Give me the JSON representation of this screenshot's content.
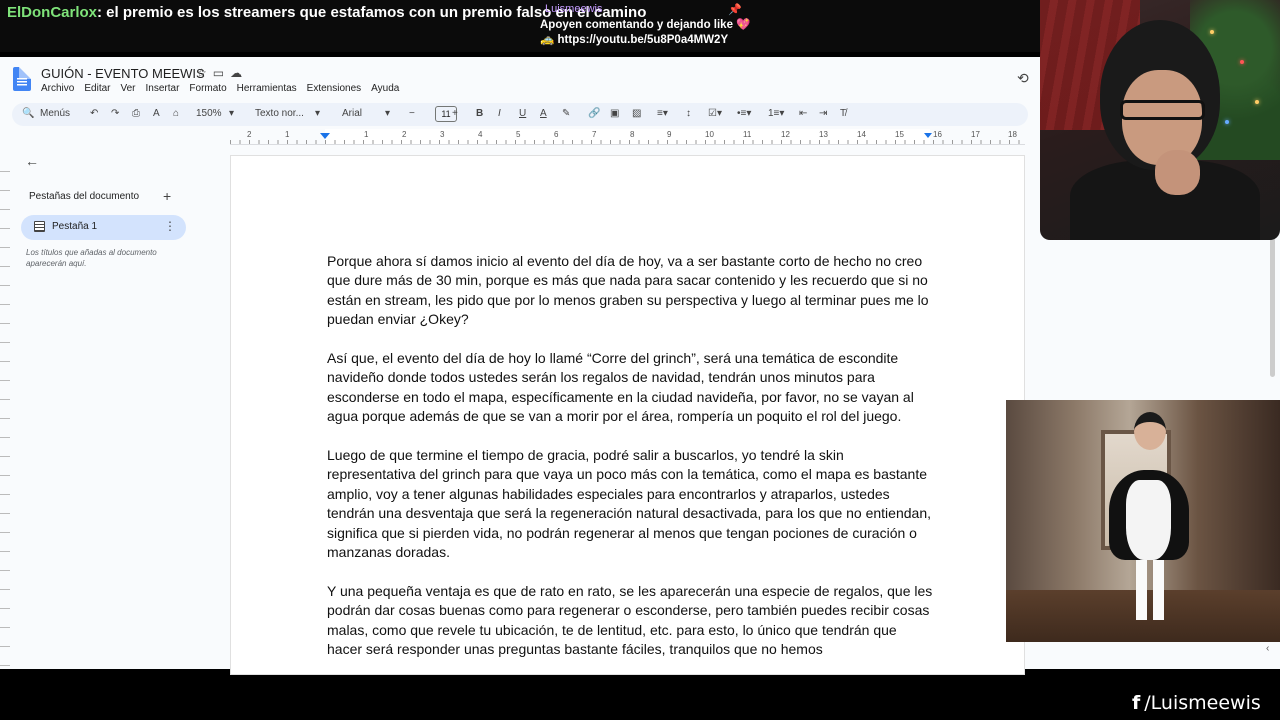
{
  "stream": {
    "chat_user": "ElDonCarlox",
    "chat_message": ": el premio es los streamers que estafamos con un premio falso en el camino",
    "pinned_user": "Luismeewis",
    "pinned_message": "Apoyen comentando y dejando like 💖",
    "pinned_link": "🚕 https://youtu.be/5u8P0a4MW2Y",
    "social_handle": "/Luismeewis",
    "social_icon": "facebook-icon"
  },
  "docs": {
    "title": "GUIÓN - EVENTO MEEWIS",
    "menu": [
      "Archivo",
      "Editar",
      "Ver",
      "Insertar",
      "Formato",
      "Herramientas",
      "Extensiones",
      "Ayuda"
    ],
    "toolbar": {
      "search": "Menús",
      "zoom": "150%",
      "style": "Texto nor...",
      "font": "Arial",
      "font_size": "11"
    },
    "ruler_numbers": [
      "2",
      "1",
      "1",
      "2",
      "3",
      "4",
      "5",
      "6",
      "7",
      "8",
      "9",
      "10",
      "11",
      "12",
      "13",
      "14",
      "15",
      "16",
      "17",
      "18"
    ],
    "sidebar": {
      "heading": "Pestañas del documento",
      "tab_label": "Pestaña 1",
      "hint": "Los títulos que añadas al documento aparecerán aquí."
    },
    "paragraphs": [
      "Porque ahora sí damos inicio al evento del día de hoy, va a ser bastante corto de hecho no creo que dure más de 30 min, porque es más que nada para sacar contenido y les recuerdo que si no están en stream, les pido que por lo menos graben su perspectiva y luego al terminar pues me lo puedan enviar ¿Okey?",
      "Así que, el evento del día de hoy lo llamé “Corre del grinch”, será una temática de escondite navideño donde todos ustedes serán los regalos de navidad, tendrán unos minutos para esconderse en todo el mapa, específicamente en la ciudad navideña, por favor, no se vayan al agua porque además de que se van a morir por el área, rompería un poquito el rol del juego.",
      "Luego de que termine el tiempo de gracia, podré salir a buscarlos, yo tendré la skin representativa del grinch para que vaya un poco más con la temática, como el mapa es bastante amplio, voy a tener algunas habilidades especiales para encontrarlos y atraparlos, ustedes tendrán una desventaja que será la regeneración natural desactivada, para los que no entiendan, significa que si pierden vida, no podrán regenerar al menos que tengan pociones de curación o manzanas doradas.",
      "Y una pequeña ventaja es que de rato en rato, se les aparecerán una especie de regalos, que les podrán dar cosas buenas como para regenerar o esconderse, pero también puedes recibir cosas malas, como que revele tu ubicación, te de lentitud, etc. para esto, lo único que tendrán que hacer será responder unas preguntas bastante fáciles, tranquilos que no hemos"
    ]
  }
}
